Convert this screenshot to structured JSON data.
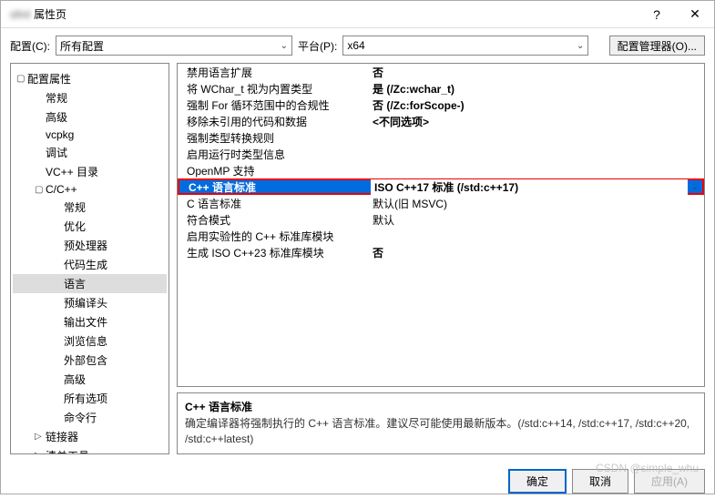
{
  "titlebar": {
    "blurred": "sfml",
    "title": "属性页",
    "help": "?",
    "close": "✕"
  },
  "topbar": {
    "config_label": "配置(C):",
    "config_value": "所有配置",
    "platform_label": "平台(P):",
    "platform_value": "x64",
    "config_manager": "配置管理器(O)..."
  },
  "tree": [
    {
      "label": "配置属性",
      "level": 0,
      "exp": "▢"
    },
    {
      "label": "常规",
      "level": 1
    },
    {
      "label": "高级",
      "level": 1
    },
    {
      "label": "vcpkg",
      "level": 1
    },
    {
      "label": "调试",
      "level": 1
    },
    {
      "label": "VC++ 目录",
      "level": 1
    },
    {
      "label": "C/C++",
      "level": 1,
      "exp": "▢"
    },
    {
      "label": "常规",
      "level": 2
    },
    {
      "label": "优化",
      "level": 2
    },
    {
      "label": "预处理器",
      "level": 2
    },
    {
      "label": "代码生成",
      "level": 2
    },
    {
      "label": "语言",
      "level": 2,
      "selected": true
    },
    {
      "label": "预编译头",
      "level": 2
    },
    {
      "label": "输出文件",
      "level": 2
    },
    {
      "label": "浏览信息",
      "level": 2
    },
    {
      "label": "外部包含",
      "level": 2
    },
    {
      "label": "高级",
      "level": 2
    },
    {
      "label": "所有选项",
      "level": 2
    },
    {
      "label": "命令行",
      "level": 2
    },
    {
      "label": "链接器",
      "level": 1,
      "exp": "▷"
    },
    {
      "label": "清单工具",
      "level": 1,
      "exp": "▷"
    }
  ],
  "props": [
    {
      "key": "禁用语言扩展",
      "val": "否"
    },
    {
      "key": "将 WChar_t 视为内置类型",
      "val": "是 (/Zc:wchar_t)"
    },
    {
      "key": "强制 For 循环范围中的合规性",
      "val": "否 (/Zc:forScope-)"
    },
    {
      "key": "移除未引用的代码和数据",
      "val": "<不同选项>"
    },
    {
      "key": "强制类型转换规则",
      "val": ""
    },
    {
      "key": "启用运行时类型信息",
      "val": ""
    },
    {
      "key": "OpenMP 支持",
      "val": ""
    },
    {
      "key": "C++ 语言标准",
      "val": "ISO C++17 标准 (/std:c++17)",
      "highlight": true,
      "dropdown": true
    },
    {
      "key": "C 语言标准",
      "val": "默认(旧 MSVC)"
    },
    {
      "key": "符合模式",
      "val": "默认"
    },
    {
      "key": "启用实验性的 C++ 标准库模块",
      "val": ""
    },
    {
      "key": "生成 ISO C++23 标准库模块",
      "val": "否"
    }
  ],
  "desc": {
    "title": "C++ 语言标准",
    "text": "确定编译器将强制执行的 C++ 语言标准。建议尽可能使用最新版本。(/std:c++14, /std:c++17, /std:c++20, /std:c++latest)"
  },
  "footer": {
    "ok": "确定",
    "cancel": "取消",
    "apply": "应用(A)"
  },
  "watermark": "CSDN @simple_whu"
}
